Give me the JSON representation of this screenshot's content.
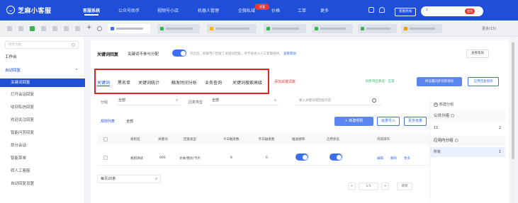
{
  "app": {
    "logo_text": "芝麻小客服"
  },
  "topnav": {
    "items": [
      {
        "label": "客服系统",
        "active": true
      },
      {
        "label": "公众号助手"
      },
      {
        "label": "视频号小店"
      },
      {
        "label": "机器人管理"
      },
      {
        "label": "企微私域"
      },
      {
        "label": "价格"
      },
      {
        "label": "工单"
      },
      {
        "label": "更多"
      }
    ],
    "badge": "优惠",
    "help_label": "客服热线",
    "user_name": "1",
    "user_badge": "会员"
  },
  "tabstrip": {
    "more_label": "更多(15)"
  },
  "sidebar": {
    "search_placeholder": "搜索功能",
    "items": [
      {
        "label": "工作台",
        "type": "group"
      },
      {
        "label": "自动回复",
        "type": "group-open"
      },
      {
        "label": "关键词回复",
        "type": "active"
      },
      {
        "label": "打开会话回复"
      },
      {
        "label": "收到私信回复"
      },
      {
        "label": "欢迎关注回复"
      },
      {
        "label": "智能问答回复"
      },
      {
        "label": "划分会话"
      },
      {
        "label": "智能菜单"
      },
      {
        "label": "转人工客服"
      },
      {
        "label": "自动回复设置"
      }
    ]
  },
  "header": {
    "title": "关键词回复",
    "subtitle": "关键词不参与分配",
    "desc": "开启后，如果用户回复了关键词回复，将不会进入人工客服接待。",
    "desc_link": "查看帮助",
    "help_button": "查看帮助"
  },
  "tabs": [
    {
      "label": "关键词",
      "active": true
    },
    {
      "label": "黑名单"
    },
    {
      "label": "关键词统计"
    },
    {
      "label": "触发时间分析"
    },
    {
      "label": "业务查询"
    },
    {
      "label": "关键词搜索高级"
    }
  ],
  "add_keyword_link": "添加关键词数",
  "status_text": "同步开启状态：正常",
  "buttons": {
    "sync": "将设置同步到其他号",
    "apply": "应用回复规则"
  },
  "filters": {
    "group_label": "分组",
    "group_value": "全部",
    "reply_label": "回复类型",
    "reply_value": "全部",
    "search_placeholder": "输入关键词或回复内容"
  },
  "subtabs": [
    {
      "label": "规则列表",
      "active": true
    },
    {
      "label": "全部"
    }
  ],
  "actions": {
    "new": "新建规则",
    "import": "批量导入",
    "batch": "更多批量"
  },
  "table": {
    "columns": [
      "规则名",
      "关键词",
      "回复类型",
      "今日触发数",
      "昨日触发数",
      "推送保障",
      "启用状态",
      "内容操作"
    ],
    "rows": [
      {
        "name": "规则测试",
        "keyword": "000",
        "type": "文本/图文/卡片",
        "today": "0",
        "yesterday": "0",
        "ops": [
          "编辑",
          "删除",
          "更多"
        ]
      }
    ]
  },
  "pagination": {
    "page_size": "每页20条",
    "prev": "<",
    "current": "1/1",
    "next": ">",
    "jump": "跳转"
  },
  "group_panel": {
    "new_label": "新建分组",
    "public_label": "公共分组",
    "public_rows": [
      {
        "name": "11",
        "count": "2"
      }
    ],
    "app_label": "应用内分组",
    "app_rows": [
      {
        "name": "所有",
        "count": "1"
      }
    ]
  },
  "colors": {
    "primary": "#1f4ed9",
    "accent": "#3d6ff2",
    "highlight_box": "#e02424"
  }
}
